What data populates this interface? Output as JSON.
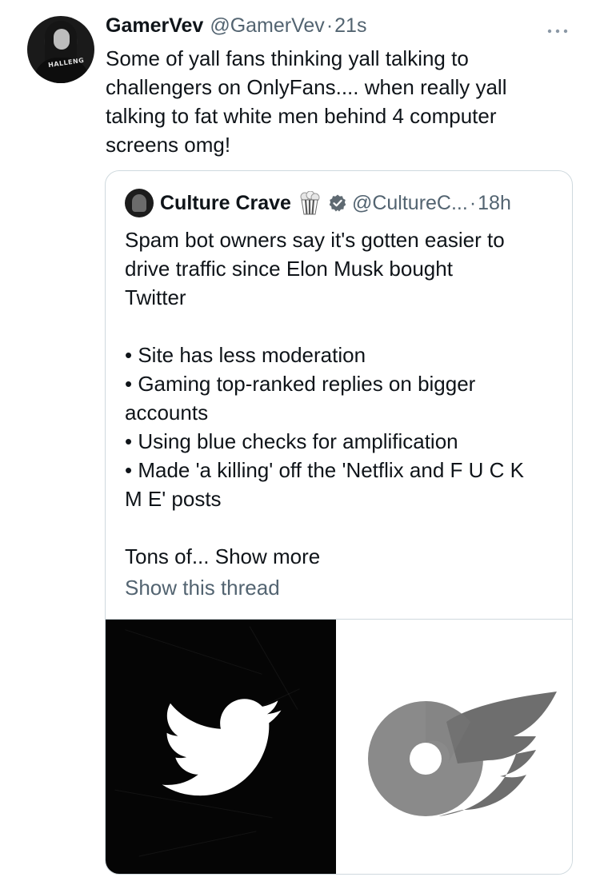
{
  "tweet": {
    "name": "GamerVev",
    "handle": "@GamerVev",
    "separator": "·",
    "time": "21s",
    "more_icon": "more-horizontal-icon",
    "lines": [
      "Some of yall fans thinking yall talking to",
      "challengers on OnlyFans.... when really yall",
      "talking to fat white men behind 4 computer",
      "screens omg!"
    ],
    "avatar_text": "HALLENG"
  },
  "quote": {
    "name": "Culture Crave",
    "emoji_icon": "popcorn-icon",
    "verified_icon": "verified-badge-icon",
    "handle": "@CultureC...",
    "separator": "·",
    "time": "18h",
    "lines": [
      "Spam bot owners say it's gotten easier to",
      "drive traffic since Elon Musk bought",
      "Twitter",
      "",
      "• Site has less moderation",
      "• Gaming top-ranked replies on bigger",
      "accounts",
      "• Using blue checks for amplification",
      "• Made 'a killing' off the 'Netflix and F U C K",
      "M E' posts",
      "",
      "Tons of... Show more"
    ],
    "show_thread": "Show this thread",
    "media": {
      "left": "twitter-bird-logo",
      "right": "onlyfans-logo"
    }
  },
  "colors": {
    "text": "#0f1419",
    "secondary": "#536471",
    "border": "#cfd9de"
  }
}
